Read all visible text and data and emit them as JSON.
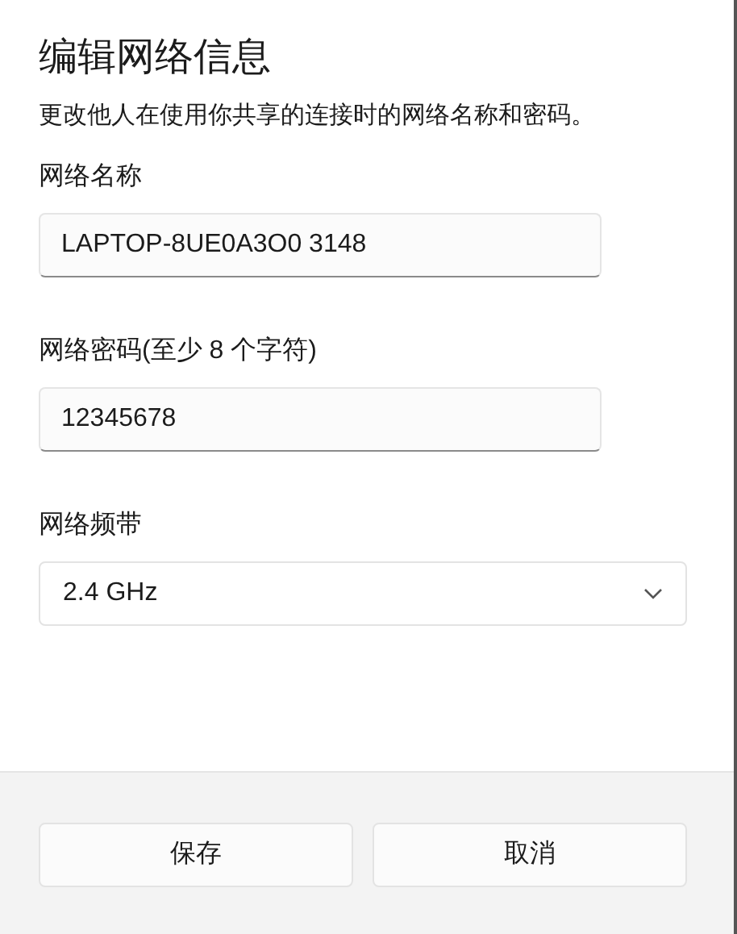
{
  "dialog": {
    "title": "编辑网络信息",
    "description": "更改他人在使用你共享的连接时的网络名称和密码。"
  },
  "fields": [
    {
      "kind": "text",
      "label": "网络名称",
      "value": "LAPTOP-8UE0A3O0 3148"
    },
    {
      "kind": "text",
      "label": "网络密码(至少 8 个字符)",
      "value": "12345678"
    },
    {
      "kind": "select",
      "label": "网络频带",
      "value": "2.4 GHz"
    }
  ],
  "buttons": [
    "保存",
    "取消"
  ]
}
